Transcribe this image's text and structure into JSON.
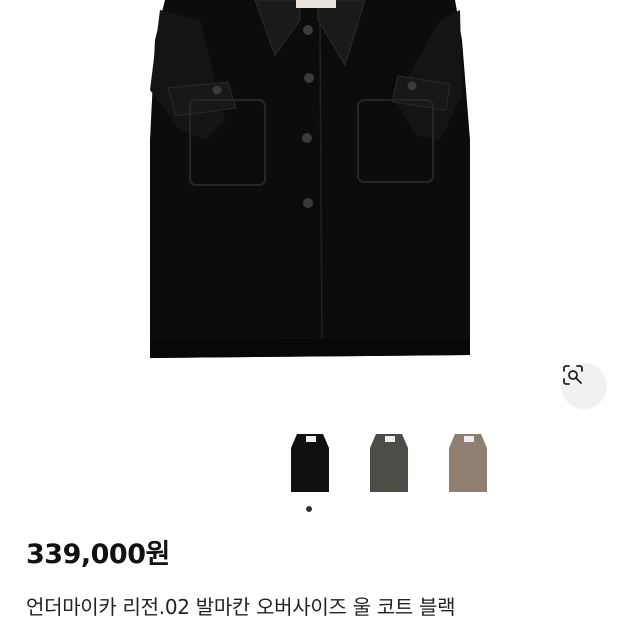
{
  "product": {
    "price": "339,000원",
    "name": "언더마이카 리전.02 발마칸 오버사이즈 울 코트 블랙"
  },
  "gallery": {
    "thumbnails": [
      {
        "label": "black",
        "color": "#101010"
      },
      {
        "label": "khaki",
        "color": "#4b4e46"
      },
      {
        "label": "brown",
        "color": "#8e7f71"
      }
    ],
    "active_index": 0
  },
  "icons": {
    "visual_search": "lens-search-icon"
  }
}
